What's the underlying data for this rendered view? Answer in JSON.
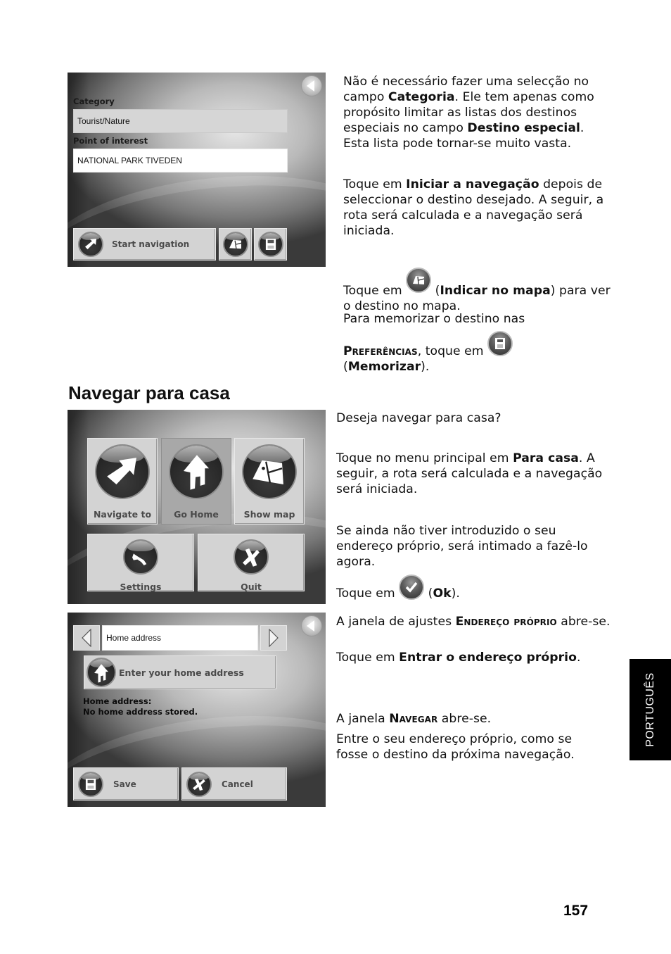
{
  "screens": {
    "poi": {
      "category_label": "Category",
      "category_value": "Tourist/Nature",
      "poi_label": "Point of interest",
      "poi_value": "NATIONAL PARK TIVEDEN",
      "start_navigation": "Start navigation",
      "icons": [
        "back-icon",
        "navigate-arrow-icon",
        "map-icon",
        "save-disk-icon"
      ]
    },
    "main_menu": {
      "tiles": [
        {
          "label": "Navigate to",
          "icon": "navigate-arrow-icon",
          "active": false
        },
        {
          "label": "Go Home",
          "icon": "house-icon",
          "active": true
        },
        {
          "label": "Show map",
          "icon": "map-icon",
          "active": false
        },
        {
          "label": "Settings",
          "icon": "wrench-icon",
          "active": false
        },
        {
          "label": "Quit",
          "icon": "quit-x-icon",
          "active": false
        }
      ]
    },
    "home_address": {
      "selector_value": "Home address",
      "enter_button": "Enter your home address",
      "info_title": "Home address:",
      "info_value": "No home address stored.",
      "save": "Save",
      "cancel": "Cancel"
    }
  },
  "text": {
    "p1": {
      "a": "Não é necessário fazer uma selecção no campo ",
      "b1": "Categoria",
      "c": ". Ele tem apenas como propósito limitar as listas dos destinos especiais no campo ",
      "b2": "Destino especial",
      "d": ". Esta lista pode tornar-se muito vasta."
    },
    "p2": {
      "a": "Toque em ",
      "b": "Iniciar a navegação",
      "c": " depois de seleccionar o destino desejado. A seguir, a rota será calculada e a navegação será iniciada."
    },
    "p3": {
      "a": "Toque em ",
      "b": "Indicar no mapa",
      "c": ") para ver o destino no mapa."
    },
    "p4": {
      "a": "Para memorizar o destino nas",
      "sc": "Preferências",
      "c": ", toque em ",
      "b": "Memorizar",
      "d": ")."
    },
    "heading": "Navegar para casa",
    "p5": "Deseja navegar para casa?",
    "p6": {
      "a": "Toque no menu principal em ",
      "b": "Para casa",
      "c": ". A seguir, a rota será calculada e a navegação será iniciada."
    },
    "p7": "Se ainda não tiver introduzido o seu endereço próprio, será intimado a fazê-lo agora.",
    "p8": {
      "a": "Toque em ",
      "b": "Ok",
      "c": ")."
    },
    "p9": {
      "a": "A janela de ajustes ",
      "sc": "Endereço próprio",
      "c": " abre-se."
    },
    "p10": {
      "a": "Toque em ",
      "b": "Entrar o endereço próprio",
      "c": "."
    },
    "p11": {
      "a": "A janela ",
      "sc": "Navegar",
      "c": " abre-se."
    },
    "p12": "Entre o seu endereço próprio, como se fosse o destino da próxima navegação."
  },
  "sidebar_tab": "PORTUGUÊS",
  "page_number": "157"
}
